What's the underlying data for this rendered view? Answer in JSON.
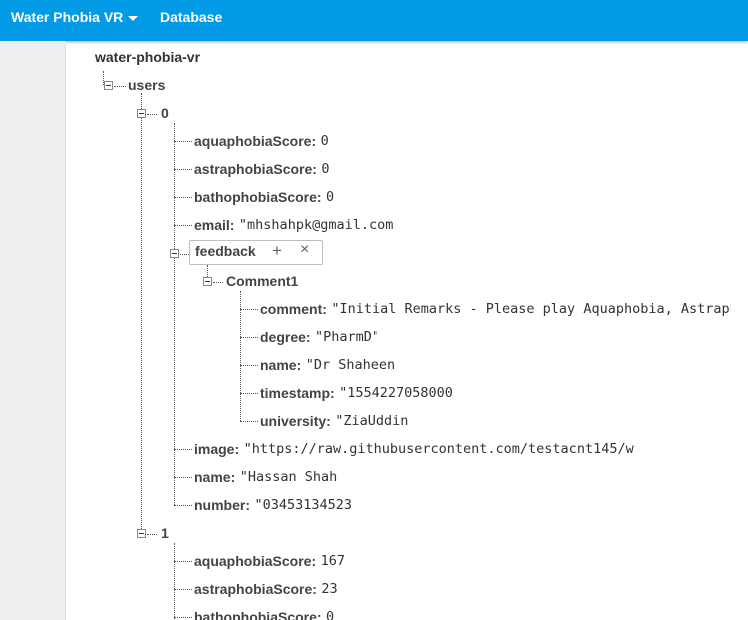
{
  "header": {
    "app_name": "Water Phobia VR",
    "section": "Database",
    "accent_color": "#039be5"
  },
  "tree": {
    "root": "water-phobia-vr",
    "users_key": "users",
    "user0": {
      "key": "0",
      "fields": [
        {
          "key": "aquaphobiaScore:",
          "value": "0"
        },
        {
          "key": "astraphobiaScore:",
          "value": "0"
        },
        {
          "key": "bathophobiaScore:",
          "value": "0"
        },
        {
          "key": "email:",
          "value": "\"mhshahpk@gmail.com"
        }
      ],
      "feedback": {
        "key": "feedback",
        "add_icon": "+",
        "remove_icon": "×",
        "comment_key": "Comment1",
        "fields": [
          {
            "key": "comment:",
            "value": "\"Initial Remarks - Please play Aquaphobia, Astraphobia"
          },
          {
            "key": "degree:",
            "value": "\"PharmD\""
          },
          {
            "key": "name:",
            "value": "\"Dr Shaheen"
          },
          {
            "key": "timestamp:",
            "value": "\"1554227058000"
          },
          {
            "key": "university:",
            "value": "\"ZiaUddin"
          }
        ]
      },
      "fields_after": [
        {
          "key": "image:",
          "value": "\"https://raw.githubusercontent.com/testacnt145/w"
        },
        {
          "key": "name:",
          "value": "\"Hassan Shah"
        },
        {
          "key": "number:",
          "value": "\"03453134523"
        }
      ]
    },
    "user1": {
      "key": "1",
      "fields": [
        {
          "key": "aquaphobiaScore:",
          "value": "167"
        },
        {
          "key": "astraphobiaScore:",
          "value": "23"
        },
        {
          "key": "bathophobiaScore:",
          "value": "0"
        }
      ]
    }
  }
}
